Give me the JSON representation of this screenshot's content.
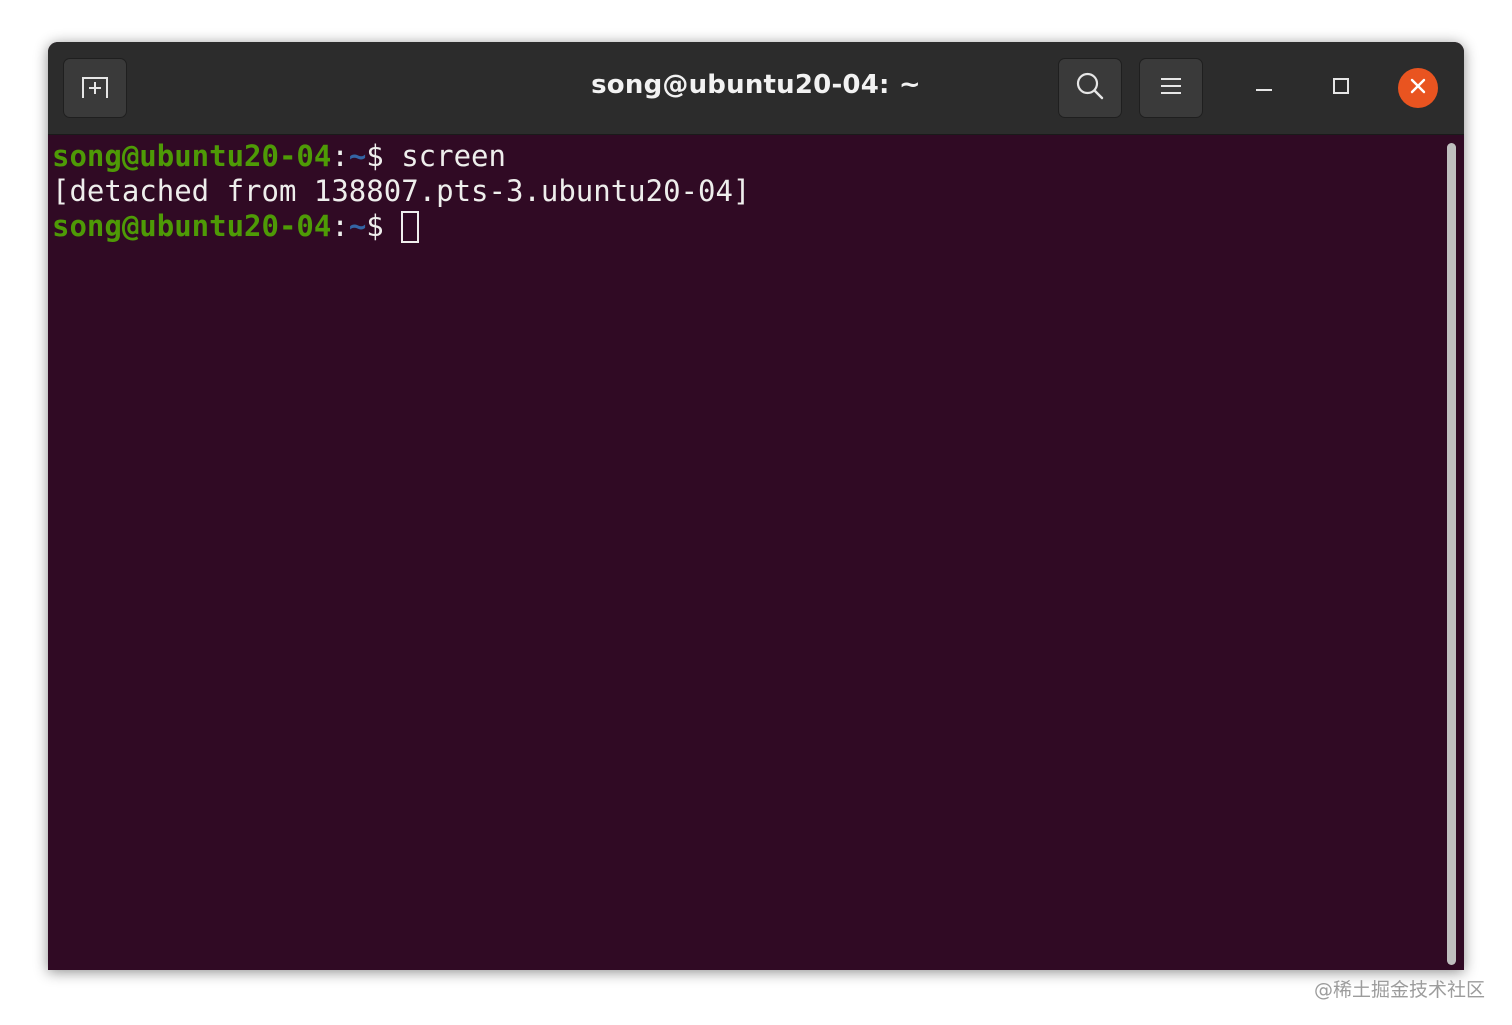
{
  "window": {
    "title": "song@ubuntu20-04: ~"
  },
  "toolbar": {
    "new_tab_icon": "new-tab-icon",
    "search_icon": "search-icon",
    "menu_icon": "hamburger-menu-icon",
    "minimize_icon": "minimize-icon",
    "maximize_icon": "maximize-icon",
    "close_icon": "close-icon"
  },
  "terminal": {
    "lines": [
      {
        "user_host": "song@ubuntu20-04",
        "colon": ":",
        "path": "~",
        "prompt_symbol": "$ ",
        "command": "screen"
      },
      {
        "output": "[detached from 138807.pts-3.ubuntu20-04]"
      },
      {
        "user_host": "song@ubuntu20-04",
        "colon": ":",
        "path": "~",
        "prompt_symbol": "$ ",
        "command": ""
      }
    ]
  },
  "colors": {
    "terminal_bg": "#300a24",
    "prompt_user": "#4e9a06",
    "prompt_path": "#3465a4",
    "text": "#eeeeec",
    "titlebar": "#2c2c2c",
    "close_button": "#e95420"
  },
  "watermark": {
    "text": "@稀土掘金技术社区"
  }
}
